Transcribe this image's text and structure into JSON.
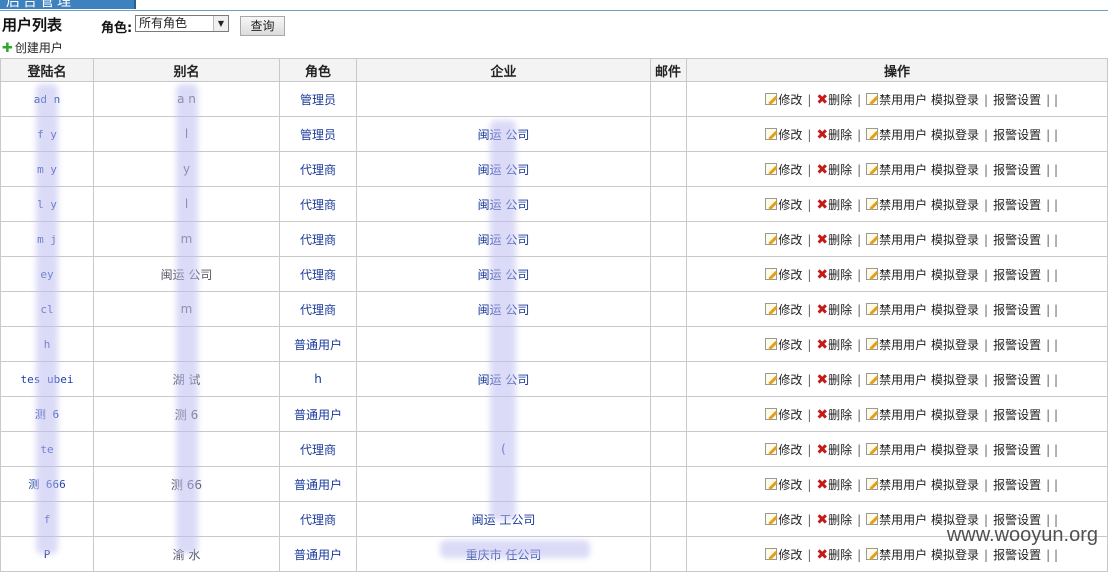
{
  "header": {
    "tab_label": "后台管理"
  },
  "page": {
    "title": "用户列表"
  },
  "filter": {
    "role_label": "角色:",
    "role_selected": "所有角色",
    "query_label": "查询"
  },
  "actions": {
    "create_user": "创建用户"
  },
  "table": {
    "columns": [
      "登陆名",
      "别名",
      "角色",
      "企业",
      "邮件",
      "操作"
    ],
    "ops": {
      "edit": "修改",
      "delete": "删除",
      "disable": "禁用用户",
      "simulate": "模拟登录",
      "alarm": "报警设置",
      "trailing": "| |"
    },
    "rows": [
      {
        "login": "ad  n",
        "alias": "a   n",
        "role": "管理员",
        "company": "",
        "email": ""
      },
      {
        "login": "f  y",
        "alias": "l   ",
        "role": "管理员",
        "company": "闽运    公司",
        "email": ""
      },
      {
        "login": "m  y",
        "alias": "   y",
        "role": "代理商",
        "company": "闽运    公司",
        "email": ""
      },
      {
        "login": "l  y",
        "alias": "l   ",
        "role": "代理商",
        "company": "闽运    公司",
        "email": ""
      },
      {
        "login": "m  j",
        "alias": "m",
        "role": "代理商",
        "company": "闽运    公司",
        "email": ""
      },
      {
        "login": "  ey",
        "alias": "闽运    公司",
        "role": "代理商",
        "company": "闽运    公司",
        "email": ""
      },
      {
        "login": "  cl",
        "alias": "m",
        "role": "代理商",
        "company": "闽运    公司",
        "email": ""
      },
      {
        "login": "h",
        "alias": "",
        "role": "普通用户",
        "company": "",
        "email": ""
      },
      {
        "login": "tes  ubei",
        "alias": "湖   试",
        "role": "h",
        "company": "闽运    公司",
        "email": ""
      },
      {
        "login": "测  6",
        "alias": "测   6",
        "role": "普通用户",
        "company": "",
        "email": ""
      },
      {
        "login": "te  ",
        "alias": "  ",
        "role": "代理商",
        "company": "(",
        "email": ""
      },
      {
        "login": "测 666",
        "alias": "测  66",
        "role": "普通用户",
        "company": "",
        "email": ""
      },
      {
        "login": "  f",
        "alias": "",
        "role": "代理商",
        "company": "闽运    工公司",
        "email": ""
      },
      {
        "login": "P  ",
        "alias": "渝   水",
        "role": "普通用户",
        "company": "重庆市         任公司",
        "email": ""
      }
    ]
  },
  "watermark": "www.wooyun.org",
  "colors": {
    "header_bg": "#f3f3f3",
    "link": "#1a3a9a",
    "delete_icon": "#c41a1a",
    "plus_icon": "#2fa82f",
    "tab_bg": "#3d82bf"
  }
}
